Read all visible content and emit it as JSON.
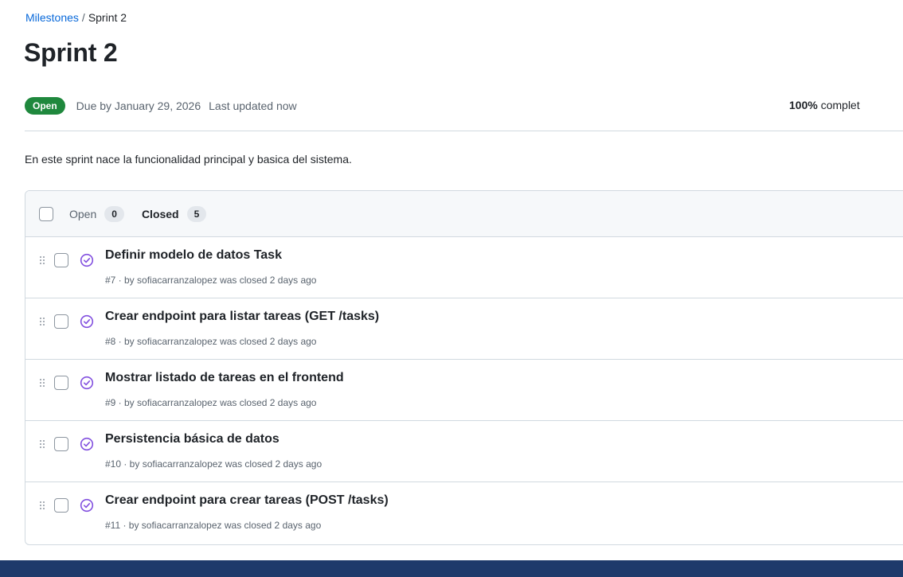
{
  "breadcrumb": {
    "parent": "Milestones",
    "separator": "/",
    "current": "Sprint 2"
  },
  "title": "Sprint 2",
  "status": {
    "label": "Open",
    "color": "#1f883d"
  },
  "due": "Due by January 29, 2026",
  "updated": "Last updated now",
  "progress": {
    "percent": "100%",
    "label": "complet"
  },
  "description": "En este sprint nace la funcionalidad principal y basica del sistema.",
  "tabs": {
    "open_label": "Open",
    "open_count": "0",
    "closed_label": "Closed",
    "closed_count": "5"
  },
  "issues": [
    {
      "title": "Definir modelo de datos Task",
      "meta": "#7 · by sofiacarranzalopez was closed 2 days ago"
    },
    {
      "title": "Crear endpoint para listar tareas (GET /tasks)",
      "meta": "#8 · by sofiacarranzalopez was closed 2 days ago"
    },
    {
      "title": "Mostrar listado de tareas en el frontend",
      "meta": "#9 · by sofiacarranzalopez was closed 2 days ago"
    },
    {
      "title": "Persistencia básica de datos",
      "meta": "#10 · by sofiacarranzalopez was closed 2 days ago"
    },
    {
      "title": "Crear endpoint para crear tareas (POST /tasks)",
      "meta": "#11 · by sofiacarranzalopez was closed 2 days ago"
    }
  ],
  "icons": {
    "issue_state": "issue-closed-icon",
    "drag": "grabber-icon"
  },
  "colors": {
    "accent_link": "#0969da",
    "closed_purple": "#8250df",
    "bottom_bar": "#1e3a6b"
  }
}
